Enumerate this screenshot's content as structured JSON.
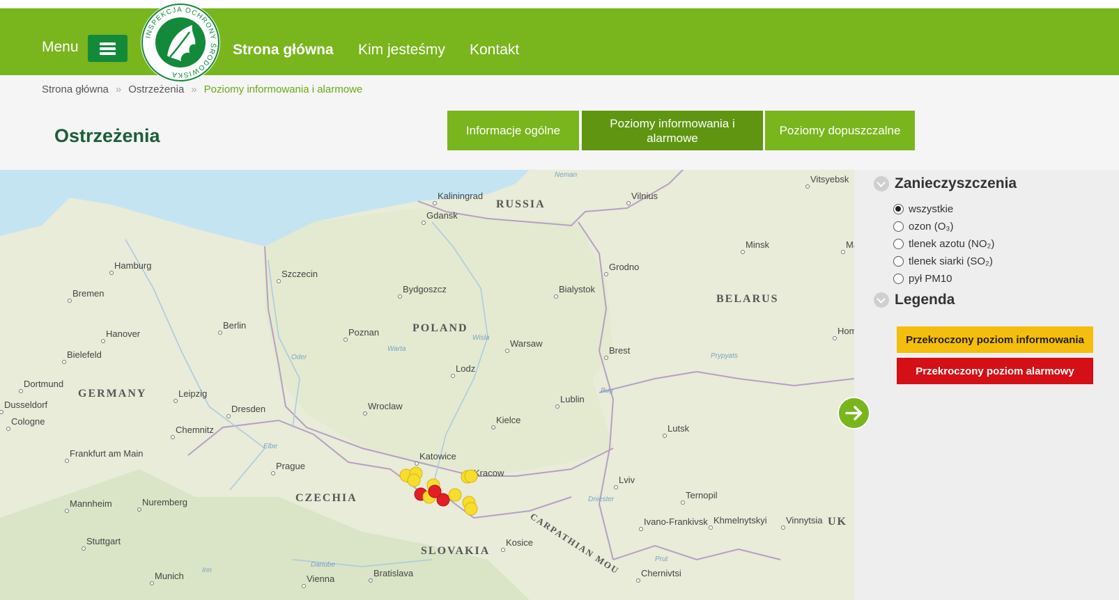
{
  "header": {
    "menu_label": "Menu",
    "logo_text": "INSPEKCJA OCHRONY ŚRODOWISKA",
    "nav": [
      "Strona główna",
      "Kim jesteśmy",
      "Kontakt"
    ],
    "brand_color": "#79b51c"
  },
  "breadcrumb": [
    "Strona główna",
    "Ostrzeżenia",
    "Poziomy informowania i alarmowe"
  ],
  "page_title": "Ostrzeżenia",
  "tabs": [
    {
      "label": "Informacje ogólne",
      "active": false
    },
    {
      "label": "Poziomy informowania i alarmowe",
      "active": true
    },
    {
      "label": "Poziomy dopuszczalne",
      "active": false
    }
  ],
  "map": {
    "cities": [
      "Kaliningrad",
      "Gdansk",
      "Vilnius",
      "Vitsyebsk",
      "Hamburg",
      "Szczecin",
      "Minsk",
      "Mahilyo",
      "Bremen",
      "Bydgoszcz",
      "Bialystok",
      "Grodno",
      "Berlin",
      "Hanover",
      "Poznan",
      "Warsaw",
      "Bielefeld",
      "Lodz",
      "Brest",
      "Hom",
      "Dortmund",
      "Dusseldorf",
      "Cologne",
      "Leipzig",
      "Dresden",
      "Wroclaw",
      "Lublin",
      "Chemnitz",
      "Kielce",
      "Lutsk",
      "Frankfurt am Main",
      "Prague",
      "Katowice",
      "Kracow",
      "Lviv",
      "Ternopil",
      "Mannheim",
      "Nuremberg",
      "Stuttgart",
      "Ivano-Frankivsk",
      "Khmelnytskyi",
      "Vinnytsia",
      "Kosice",
      "Munich",
      "Vienna",
      "Bratislava",
      "Chernivtsi"
    ],
    "countries": [
      "RUSSIA",
      "POLAND",
      "BELARUS",
      "GERMANY",
      "CZECHIA",
      "SLOVAKIA",
      "UK"
    ],
    "waters": [
      "Neman",
      "Wisla",
      "Warta",
      "Oder",
      "Prypyats",
      "Elbe",
      "Danube",
      "Dniester",
      "Prut",
      "Inn",
      "Bug"
    ],
    "region_label": "CARPATHIAN MOU",
    "markers": [
      {
        "type": "info",
        "station": 1
      },
      {
        "type": "info",
        "station": 2
      },
      {
        "type": "info",
        "station": 3
      },
      {
        "type": "info",
        "station": 4
      },
      {
        "type": "alarm",
        "station": 5
      },
      {
        "type": "info",
        "station": 6
      },
      {
        "type": "alarm",
        "station": 7
      },
      {
        "type": "info",
        "station": 8
      },
      {
        "type": "info",
        "station": 9
      },
      {
        "type": "info",
        "station": 10
      },
      {
        "type": "info",
        "station": 11
      },
      {
        "type": "info",
        "station": 12
      },
      {
        "type": "alarm",
        "station": 13
      }
    ]
  },
  "sidebar": {
    "pollutants_title": "Zanieczyszczenia",
    "options": [
      {
        "label": "wszystkie",
        "checked": true
      },
      {
        "label": "ozon (O₃)",
        "checked": false
      },
      {
        "label": "tlenek azotu (NO₂)",
        "checked": false
      },
      {
        "label": "tlenek siarki (SO₂)",
        "checked": false
      },
      {
        "label": "pył PM10",
        "checked": false
      }
    ],
    "legend_title": "Legenda",
    "legend": [
      {
        "label": "Przekroczony poziom informowania",
        "color": "#f5bd0c",
        "text_color": "#222222"
      },
      {
        "label": "Przekroczony poziom alarmowy",
        "color": "#d40f16",
        "text_color": "#ffffff"
      }
    ]
  },
  "colors": {
    "marker_info": "#f7dd2c",
    "marker_alarm": "#e21f26",
    "active_tab": "#5f9511"
  }
}
